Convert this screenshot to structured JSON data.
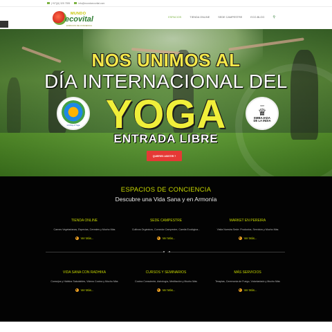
{
  "topbar": {
    "phone": "(+57)(6) 325 7595",
    "email": "info@mundoecovital.com"
  },
  "logo": {
    "top": "MUNDO",
    "main": "ecovital",
    "tagline": "ESPACIOS DE CONCIENCIA"
  },
  "nav": {
    "items": [
      "ESPACIOS",
      "TIENDA ONLINE",
      "SEDE CAMPESTRE",
      "ECO-BLOG"
    ],
    "active_index": 0,
    "search_icon": "search-icon"
  },
  "hero": {
    "line1": "NOS UNIMOS AL",
    "line2": "DÍA INTERNACIONAL DEL",
    "line3": "YOGA",
    "line4": "ENTRADA LIBRE",
    "cta": "QUIERES ASISTIR ?",
    "badge_left_caption": "Int'l Day of Yoga",
    "badge_right_top": "भारत",
    "badge_right_l1": "EMBAJADA",
    "badge_right_l2": "DE LA INDIA"
  },
  "section": {
    "title": "ESPACIOS DE CONCIENCIA",
    "subtitle": "Descubre una Vida Sana y en Armonía",
    "more_label": "Ver Más...",
    "cards": [
      {
        "title": "TIENDA ONLINE",
        "desc": "Carnes Vegetarianas, Especias, Cereales y Mucho Más"
      },
      {
        "title": "SEDE CAMPESTRE",
        "desc": "Cultivos Orgánicos, Comedor Campestre, Camila Ecológica..."
      },
      {
        "title": "MARKET EN PEREIRA",
        "desc": "Visita Nuestra Sede: Productos, Servicios y Mucho Más"
      },
      {
        "title": "VIDA SANA CON RADHIKA",
        "desc": "Consejos y Hábitos Saludables, Videos Cocina y Mucho Más"
      },
      {
        "title": "CURSOS Y SEMINARIOS",
        "desc": "Cocina Consciente, Astrología, Meditación y Mucho Más"
      },
      {
        "title": "MÁS SERVICIOS",
        "desc": "Terapias, Ceremonia de Fuego, Voluntariado y Mucho Más"
      }
    ]
  },
  "colors": {
    "accent": "#c8d800",
    "brand_green": "#2e7d32",
    "cta_red": "#e53935",
    "dark_bg": "#030303"
  }
}
